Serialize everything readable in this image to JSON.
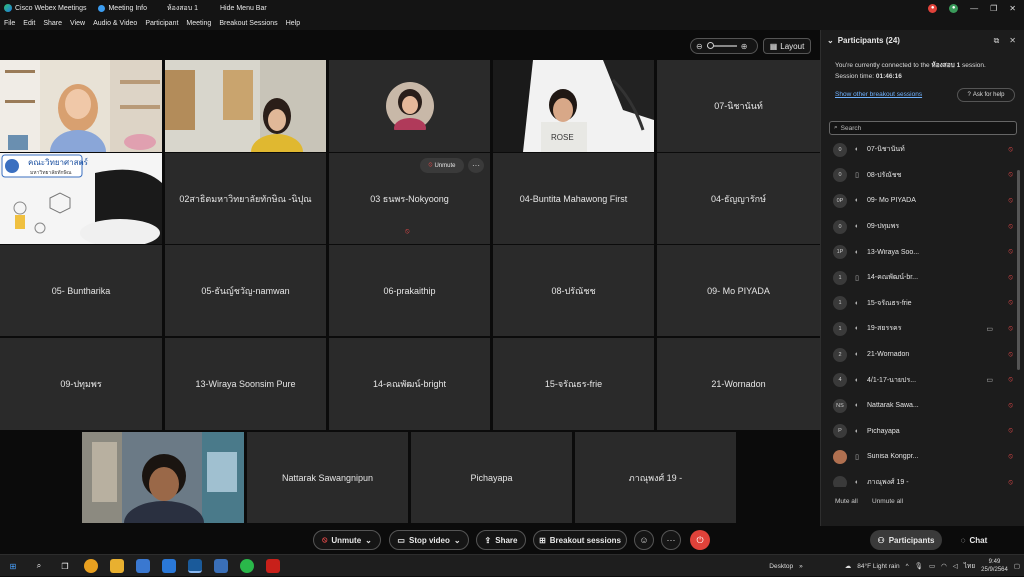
{
  "titlebar": {
    "app_name": "Cisco Webex Meetings",
    "meeting_info": "Meeting Info",
    "room": "ห้องสอบ 1",
    "hide_menu": "Hide Menu Bar"
  },
  "menu": [
    "File",
    "Edit",
    "Share",
    "View",
    "Audio & Video",
    "Participant",
    "Meeting",
    "Breakout Sessions",
    "Help"
  ],
  "stage": {
    "layout_label": "Layout",
    "unmute_label": "Unmute",
    "more_label": "···",
    "tiles": [
      "02สาธิตมหาวิทยาลัยทักษิณ -นิปุณ",
      "03 ธนพร-Nokyoong",
      "04-Buntita Mahawong First",
      "04-ธัญญารักษ์",
      "05- Buntharika",
      "05-ธันญ์ชวัญ-namwan",
      "06-prakaithip",
      "08-ปรัณัชช",
      "09- Mo PIYADA",
      "09-ปทุมพร",
      "13-Wiraya Soonsim Pure",
      "14-คณพัฒน์-bright",
      "15-จรัณธร-frie",
      "21-Wornadon",
      "Nattarak Sawangnipun",
      "Pichayapa",
      "ภาณุพงศ์ 19 -",
      "07-นิชานันท์"
    ]
  },
  "panel": {
    "title": "Participants (24)",
    "connected_pre": "You're currently connected to the",
    "connected_room": "ห้องสอบ 1",
    "connected_post": "session.",
    "session_time_label": "Session time:",
    "session_time": "01:46:16",
    "show_other": "Show other breakout sessions",
    "ask_help": "Ask for help",
    "search_placeholder": "Search",
    "participants": [
      {
        "badge": "0",
        "name": "07-นิชานันท์",
        "dev": "◐",
        "cam": ""
      },
      {
        "badge": "0",
        "name": "08-ปรัณัชช",
        "dev": "▯",
        "cam": ""
      },
      {
        "badge": "0P",
        "name": "09- Mo PIYADA",
        "dev": "◐",
        "cam": ""
      },
      {
        "badge": "0",
        "name": "09-ปทุมพร",
        "dev": "◐",
        "cam": ""
      },
      {
        "badge": "1P",
        "name": "13-Wiraya Soo...",
        "dev": "◐",
        "cam": ""
      },
      {
        "badge": "1",
        "name": "14-คณพัฒน์-br...",
        "dev": "▯",
        "cam": ""
      },
      {
        "badge": "1",
        "name": "15-จรัณธร-frie",
        "dev": "◐",
        "cam": ""
      },
      {
        "badge": "1",
        "name": "19-สยรรคร",
        "dev": "◐",
        "cam": "▭"
      },
      {
        "badge": "2",
        "name": "21-Wornadon",
        "dev": "◐",
        "cam": ""
      },
      {
        "badge": "4",
        "name": "4/1-17-นายปร...",
        "dev": "◐",
        "cam": "▭"
      },
      {
        "badge": "NS",
        "name": "Nattarak Sawa...",
        "dev": "◐",
        "cam": ""
      },
      {
        "badge": "P",
        "name": "Pichayapa",
        "dev": "◐",
        "cam": ""
      },
      {
        "badge": "",
        "name": "Sunisa Kongpr...",
        "dev": "▯",
        "cam": ""
      },
      {
        "badge": "",
        "name": "ภาณุพงศ์ 19 -",
        "dev": "◐",
        "cam": ""
      }
    ],
    "mute_all": "Mute all",
    "unmute_all": "Unmute all"
  },
  "controls": {
    "unmute": "Unmute",
    "stop_video": "Stop video",
    "share": "Share",
    "breakout": "Breakout sessions",
    "participants": "Participants",
    "chat": "Chat"
  },
  "taskbar": {
    "desktop": "Desktop",
    "weather": "84°F  Light rain",
    "lang": "ไทย",
    "time": "9:49",
    "date": "25/9/2564"
  },
  "colors": {
    "accent_blue": "#6fb2ff",
    "leave_red": "#e0423a",
    "mute_red": "#e04848"
  }
}
